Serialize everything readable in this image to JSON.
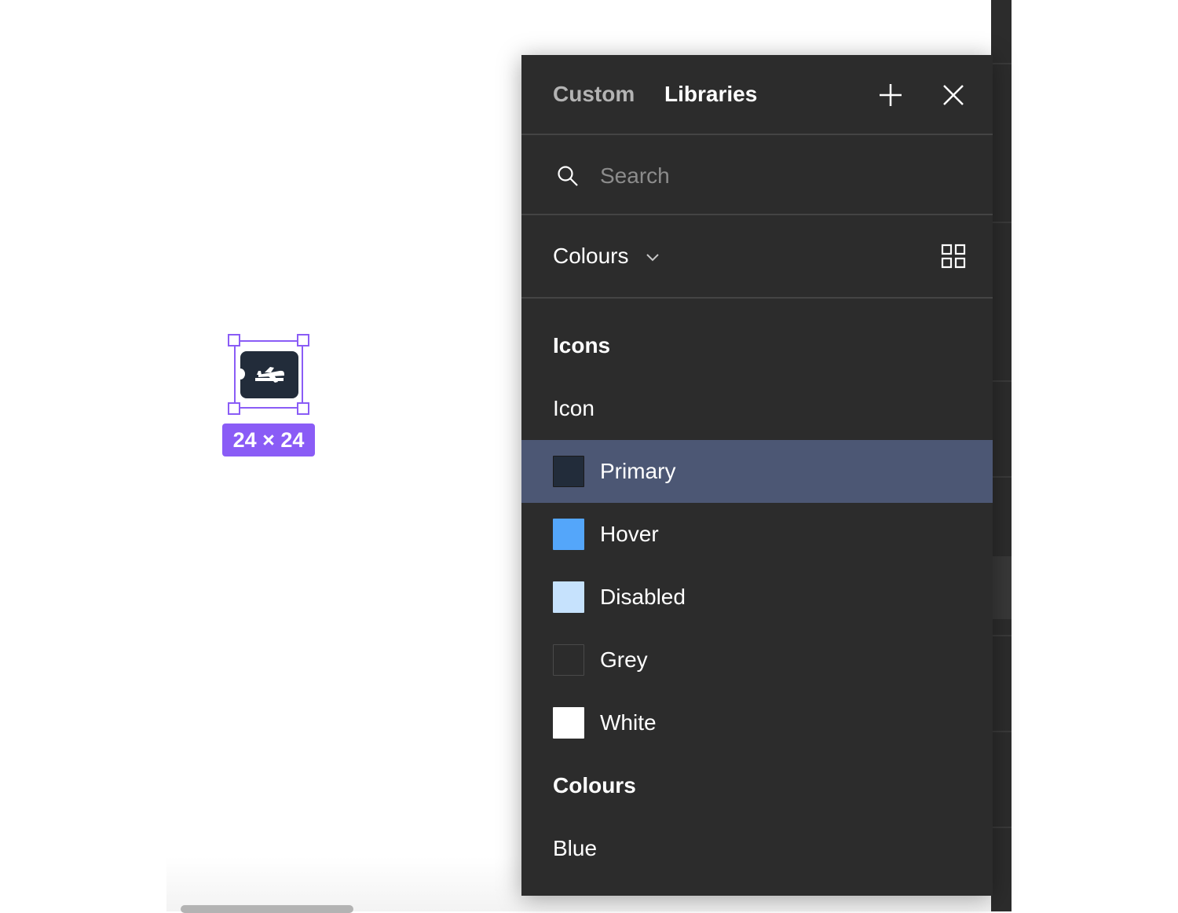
{
  "canvas": {
    "selection_size_label": "24 × 24",
    "selected_icon": "airplane-departure-icon"
  },
  "panel": {
    "tabs": [
      {
        "label": "Custom",
        "active": false
      },
      {
        "label": "Libraries",
        "active": true
      }
    ],
    "actions": {
      "add_icon": "plus-icon",
      "close_icon": "close-icon"
    },
    "search": {
      "placeholder": "Search",
      "value": "",
      "icon": "search-icon"
    },
    "filter": {
      "label": "Colours",
      "dropdown_icon": "chevron-down-icon",
      "view_icon": "grid-view-icon"
    },
    "sections": [
      {
        "title": "Icons",
        "groups": [
          {
            "title": "Icon",
            "styles": [
              {
                "label": "Primary",
                "color": "#222C3A",
                "selected": true
              },
              {
                "label": "Hover",
                "color": "#54A6FA",
                "selected": false
              },
              {
                "label": "Disabled",
                "color": "#C6E2FD",
                "selected": false
              },
              {
                "label": "Grey",
                "color": "#2C2C2C",
                "selected": false
              },
              {
                "label": "White",
                "color": "#FFFFFF",
                "selected": false
              }
            ]
          }
        ]
      },
      {
        "title": "Colours",
        "groups": [
          {
            "title": "Blue",
            "styles": []
          }
        ]
      }
    ]
  },
  "colors": {
    "panel_bg": "#2C2C2C",
    "selection_accent": "#8A5CF6",
    "selected_row_bg": "#4C5774"
  }
}
